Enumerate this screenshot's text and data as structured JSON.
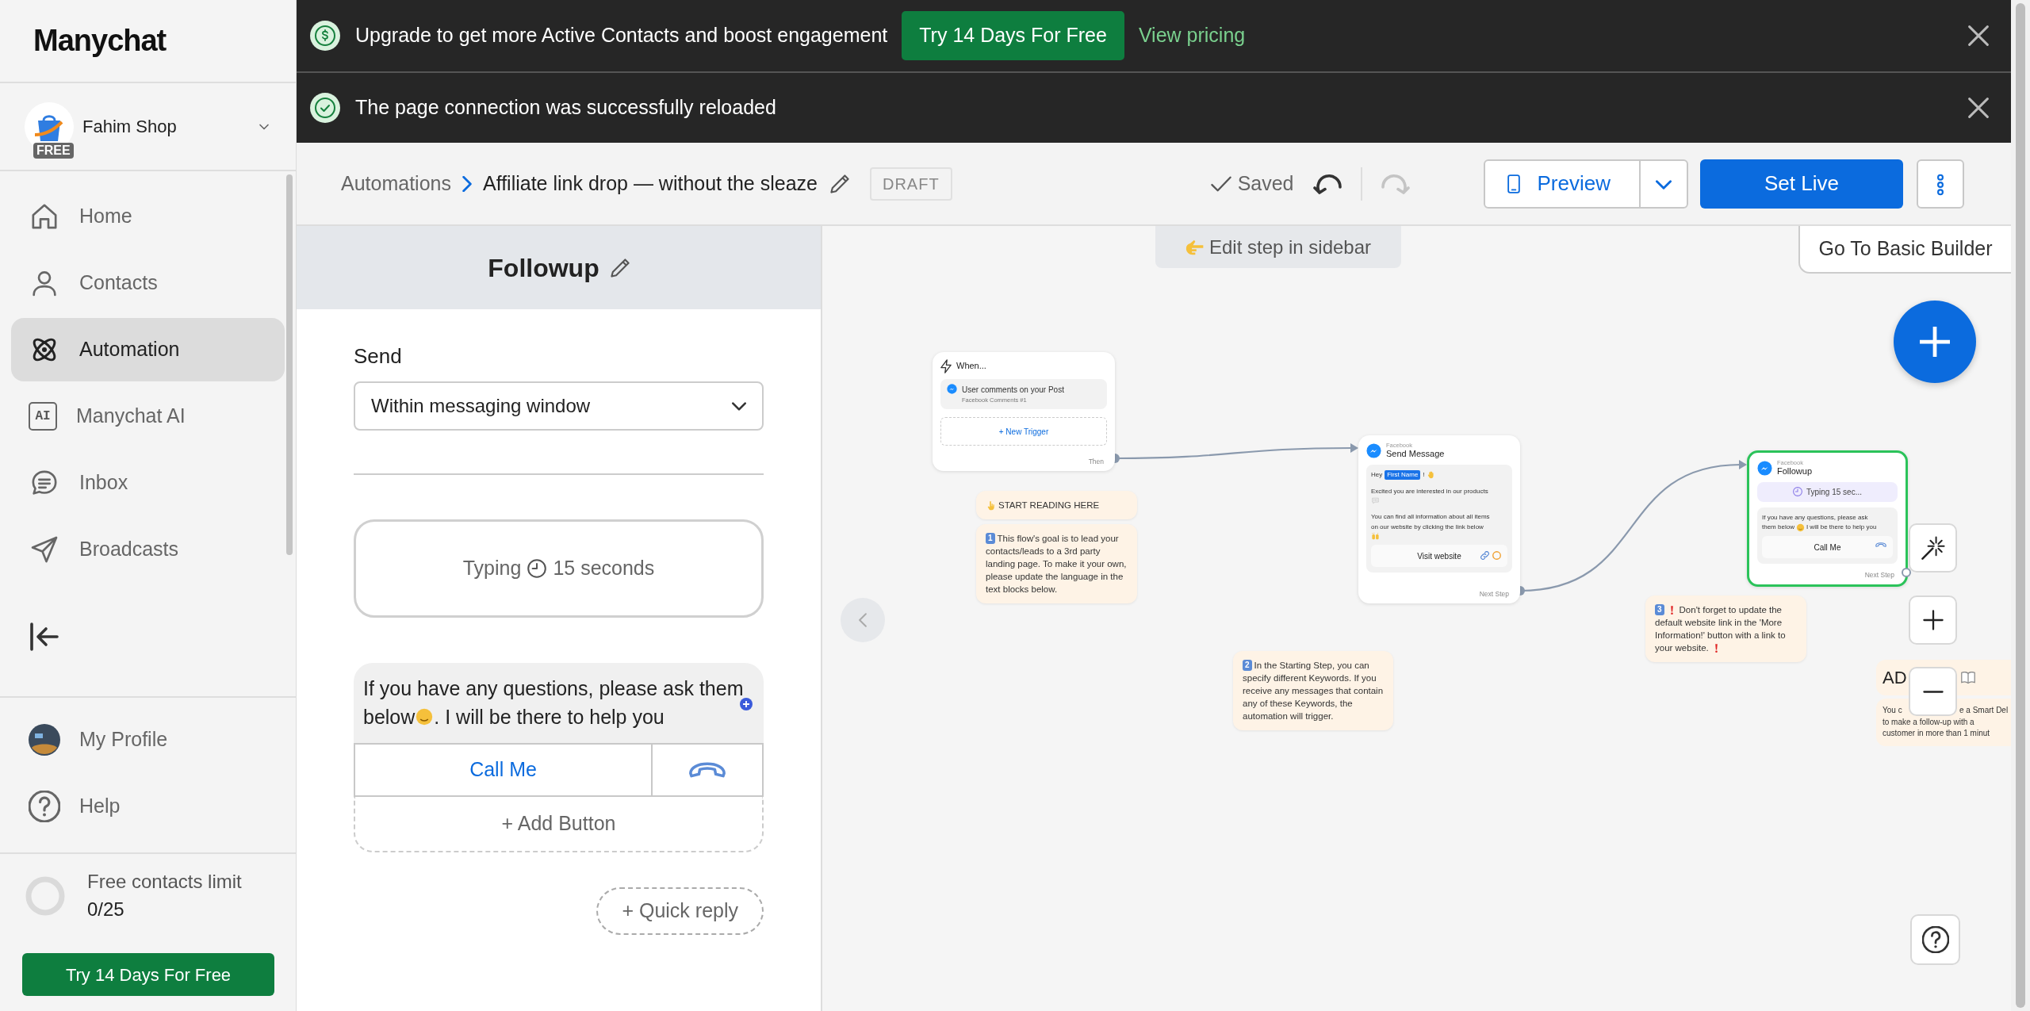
{
  "banners": [
    {
      "kind": "upgrade",
      "text": "Upgrade to get more Active Contacts and boost engagement",
      "button": "Try 14 Days For Free",
      "link": "View pricing"
    },
    {
      "kind": "success",
      "text": "The page connection was successfully reloaded"
    }
  ],
  "sidebar": {
    "logo": "Manychat",
    "account": {
      "name": "Fahim Shop",
      "plan": "FREE"
    },
    "nav": [
      {
        "label": "Home",
        "selected": false
      },
      {
        "label": "Contacts",
        "selected": false
      },
      {
        "label": "Automation",
        "selected": true
      },
      {
        "label": "Manychat AI",
        "icon_text": "AI",
        "selected": false
      },
      {
        "label": "Inbox",
        "selected": false
      },
      {
        "label": "Broadcasts",
        "selected": false
      }
    ],
    "footer_nav": [
      {
        "label": "My Profile"
      },
      {
        "label": "Help"
      }
    ],
    "contacts_limit": {
      "label": "Free contacts limit",
      "count": "0/25",
      "level": 0
    },
    "trial_button": "Try 14 Days For Free"
  },
  "header": {
    "breadcrumb": "Automations",
    "title": "Affiliate link drop — without the sleaze",
    "status": "DRAFT",
    "saved": "Saved",
    "undo_disabled": false,
    "redo_disabled": true,
    "preview": "Preview",
    "set_live": "Set Live"
  },
  "editor": {
    "title": "Followup",
    "send_label": "Send",
    "send_value": "Within messaging window",
    "typing_label": "Typing",
    "typing_value": "15 seconds",
    "message": [
      [
        {
          "kind": "text",
          "text": "If you have any questions, please ask them"
        }
      ],
      [
        {
          "kind": "text",
          "text": "below"
        },
        {
          "kind": "wink"
        },
        {
          "kind": "text",
          "text": ". I will be there to help you"
        }
      ]
    ],
    "buttons": [
      {
        "label": "Call Me",
        "kind": "call"
      }
    ],
    "add_button": "+ Add Button",
    "quick_reply": "+ Quick reply"
  },
  "canvas": {
    "hint": "Edit step in sidebar",
    "basic_builder": "Go To Basic Builder",
    "trigger": {
      "title": "When...",
      "items": [
        {
          "label": "User comments on your Post",
          "source": "Facebook Comments #1"
        }
      ],
      "new_trigger": "+ New Trigger",
      "output": "Then"
    },
    "steps": [
      {
        "channel": "Facebook",
        "title": "Send Message",
        "selected": false,
        "paragraphs": [
          [
            [
              {
                "kind": "text",
                "text": "Hey"
              },
              {
                "kind": "variable",
                "text": "First Name"
              },
              {
                "kind": "text",
                "text": "!"
              },
              {
                "kind": "wave"
              }
            ]
          ],
          [
            [
              {
                "kind": "text",
                "text": "Excited you are interested in our products"
              }
            ],
            [
              {
                "kind": "speech"
              }
            ]
          ],
          [
            [
              {
                "kind": "text",
                "text": "You can find all information about all items"
              }
            ],
            [
              {
                "kind": "text",
                "text": "on our website by clicking the link below"
              }
            ],
            [
              {
                "kind": "hands"
              }
            ]
          ]
        ],
        "buttons": [
          {
            "label": "Visit website",
            "kind": "link"
          }
        ],
        "output": "Next Step"
      },
      {
        "channel": "Facebook",
        "title": "Followup",
        "selected": true,
        "typing": "Typing 15 sec...",
        "paragraphs": [
          [
            [
              {
                "kind": "text",
                "text": "If you have any questions, please ask"
              }
            ],
            [
              {
                "kind": "text",
                "text": "them below"
              },
              {
                "kind": "wink"
              },
              {
                "kind": "text",
                "text": "I will be there to help you"
              }
            ]
          ]
        ],
        "buttons": [
          {
            "label": "Call Me",
            "kind": "call"
          }
        ],
        "output": "Next Step"
      }
    ],
    "notes": [
      {
        "lines": [
          [
            {
              "kind": "pointer"
            },
            {
              "kind": "text",
              "text": "START READING HERE"
            }
          ]
        ]
      },
      {
        "lines": [
          [
            {
              "kind": "keycap",
              "text": "1"
            },
            {
              "kind": "text",
              "text": "This flow's goal is to lead your"
            }
          ],
          [
            {
              "kind": "text",
              "text": "contacts/leads to a 3rd party"
            }
          ],
          [
            {
              "kind": "text",
              "text": "landing page. To make it your own,"
            }
          ],
          [
            {
              "kind": "text",
              "text": "please update the language in the"
            }
          ],
          [
            {
              "kind": "text",
              "text": "text blocks below."
            }
          ]
        ]
      },
      {
        "lines": [
          [
            {
              "kind": "keycap",
              "text": "2"
            },
            {
              "kind": "text",
              "text": "In the Starting Step, you can"
            }
          ],
          [
            {
              "kind": "text",
              "text": "specify different Keywords. If you"
            }
          ],
          [
            {
              "kind": "text",
              "text": "receive any messages that contain"
            }
          ],
          [
            {
              "kind": "text",
              "text": "any of these Keywords, the"
            }
          ],
          [
            {
              "kind": "text",
              "text": "automation will trigger."
            }
          ]
        ]
      },
      {
        "lines": [
          [
            {
              "kind": "keycap",
              "text": "3"
            },
            {
              "kind": "exclamation"
            },
            {
              "kind": "text",
              "text": "Don't forget to update the"
            }
          ],
          [
            {
              "kind": "text",
              "text": "default website link in the 'More"
            }
          ],
          [
            {
              "kind": "text",
              "text": "Information!' button with a link to"
            }
          ],
          [
            {
              "kind": "text",
              "text": "your website."
            },
            {
              "kind": "exclamation"
            }
          ]
        ]
      }
    ],
    "advice": {
      "title": "AD",
      "lines": [
        [
          "You c",
          "e a Smart Del"
        ],
        [
          "to make a follow-up with a"
        ],
        [
          "customer in more than 1 minut"
        ]
      ]
    }
  }
}
